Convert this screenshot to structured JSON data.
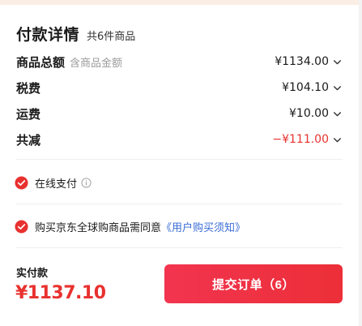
{
  "header": {
    "title": "付款详情",
    "item_count": "共6件商品"
  },
  "fees": [
    {
      "label": "商品总额",
      "sub": "含商品金额",
      "value": "¥1134.00"
    },
    {
      "label": "税费",
      "sub": "",
      "value": "¥104.10"
    },
    {
      "label": "运费",
      "sub": "",
      "value": "¥10.00"
    },
    {
      "label": "共减",
      "sub": "",
      "value": "−¥111.00"
    }
  ],
  "payment": {
    "method_label": "在线支付"
  },
  "agreement": {
    "text": "购买京东全球购商品需同意",
    "link": "《用户购买须知》"
  },
  "footer": {
    "total_label": "实付款",
    "total_amount": "¥1137.10",
    "submit_label": "提交订单（6）"
  },
  "colors": {
    "accent": "#e8312f",
    "link": "#3a6bd6",
    "button": "#ee3142"
  },
  "icons": {
    "chevron": "chevron-down-icon",
    "check": "check-circle-icon",
    "info": "info-icon"
  }
}
